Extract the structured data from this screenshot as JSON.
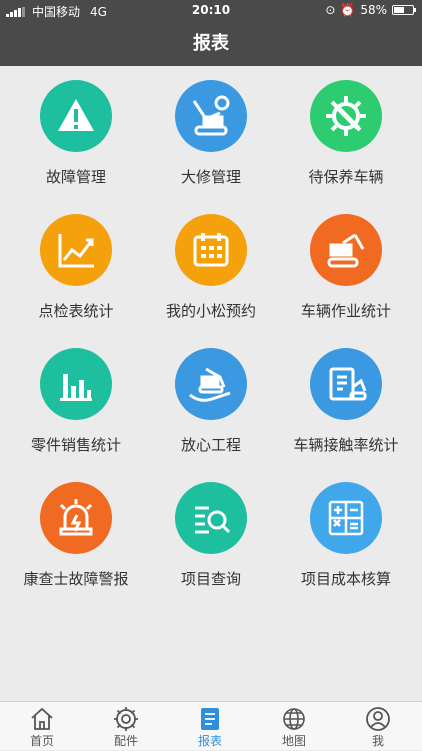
{
  "status_bar": {
    "carrier": "中国移动",
    "network": "4G",
    "time": "20:10",
    "battery_percent": "58%",
    "battery_level": 0.58
  },
  "nav": {
    "title": "报表"
  },
  "colors": {
    "teal": "#1dbf9f",
    "blue": "#3a99e0",
    "green": "#2ecc71",
    "orange": "#f5a10c",
    "red_orange": "#f06a21",
    "active_tab": "#2f8fdd"
  },
  "menu": [
    {
      "label": "故障管理",
      "icon": "warning-icon",
      "color": "#1dbf9f"
    },
    {
      "label": "大修管理",
      "icon": "excavator-repair-icon",
      "color": "#3a99e0"
    },
    {
      "label": "待保养车辆",
      "icon": "gear-wrench-icon",
      "color": "#2ecc71"
    },
    {
      "label": "点检表统计",
      "icon": "growth-chart-icon",
      "color": "#f5a10c"
    },
    {
      "label": "我的小松预约",
      "icon": "calendar-icon",
      "color": "#f5a10c"
    },
    {
      "label": "车辆作业统计",
      "icon": "excavator-icon",
      "color": "#f06a21"
    },
    {
      "label": "零件销售统计",
      "icon": "bar-chart-icon",
      "color": "#1dbf9f"
    },
    {
      "label": "放心工程",
      "icon": "hand-excavator-icon",
      "color": "#3a99e0"
    },
    {
      "label": "车辆接触率统计",
      "icon": "clipboard-excavator-icon",
      "color": "#3a99e0"
    },
    {
      "label": "康查士故障警报",
      "icon": "alarm-light-icon",
      "color": "#f06a21"
    },
    {
      "label": "项目查询",
      "icon": "list-search-icon",
      "color": "#1dbf9f"
    },
    {
      "label": "项目成本核算",
      "icon": "calculator-icon",
      "color": "#3a99e0"
    }
  ],
  "tabs": [
    {
      "label": "首页",
      "icon": "home-icon"
    },
    {
      "label": "配件",
      "icon": "gear-icon"
    },
    {
      "label": "报表",
      "icon": "report-icon",
      "active": true
    },
    {
      "label": "地图",
      "icon": "globe-icon"
    },
    {
      "label": "我",
      "icon": "user-icon"
    }
  ]
}
